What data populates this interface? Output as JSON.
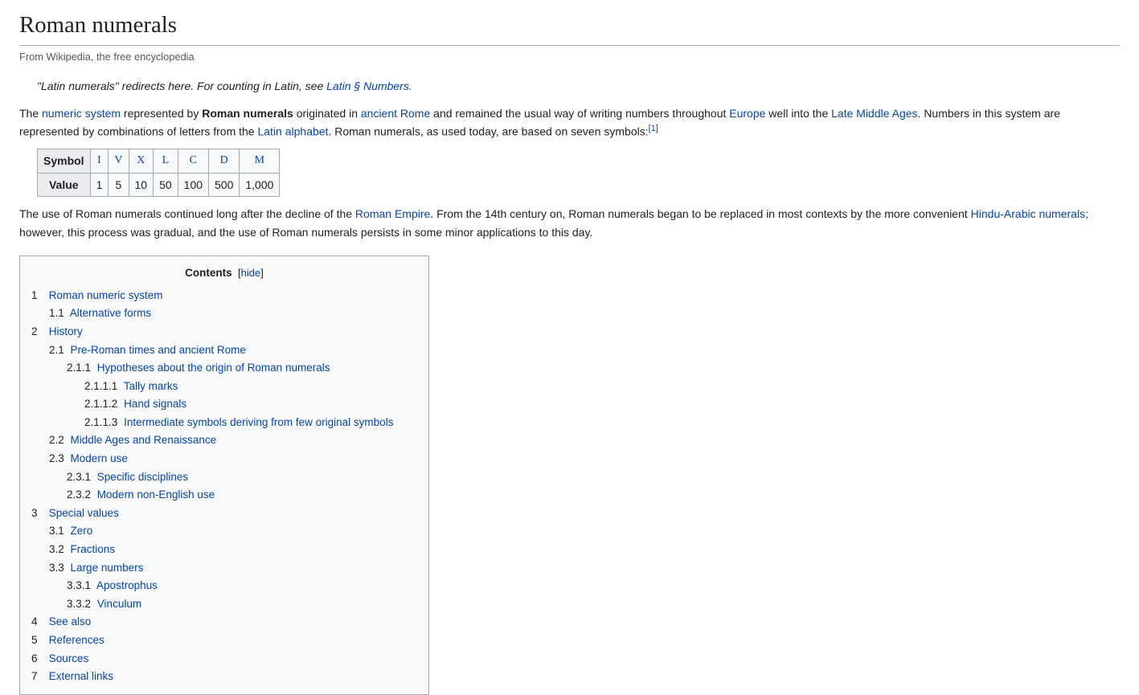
{
  "title": "Roman numerals",
  "subtitle": "From Wikipedia, the free encyclopedia",
  "hatnote": {
    "prefix": "\"Latin numerals\" redirects here. For counting in Latin, see ",
    "link": "Latin § Numbers",
    "suffix": "."
  },
  "intro": {
    "p1_a": "The ",
    "p1_link1": "numeric system",
    "p1_b": " represented by ",
    "p1_bold": "Roman numerals",
    "p1_c": " originated in ",
    "p1_link2": "ancient Rome",
    "p1_d": " and remained the usual way of writing numbers throughout ",
    "p1_link3": "Europe",
    "p1_e": " well into the ",
    "p1_link4": "Late Middle Ages",
    "p1_f": ". Numbers in this system are represented by combinations of letters from the ",
    "p1_link5": "Latin alphabet",
    "p1_g": ". Roman numerals, as used today, are based on seven symbols:",
    "p1_ref": "[1]"
  },
  "table": {
    "header_symbol": "Symbol",
    "header_value": "Value",
    "symbols": [
      "I",
      "V",
      "X",
      "L",
      "C",
      "D",
      "M"
    ],
    "values": [
      "1",
      "5",
      "10",
      "50",
      "100",
      "500",
      "1,000"
    ]
  },
  "para2": {
    "a": "The use of Roman numerals continued long after the decline of the ",
    "link1": "Roman Empire",
    "b": ". From the 14th century on, Roman numerals began to be replaced in most contexts by the more convenient ",
    "link2": "Hindu-Arabic numerals",
    "c": "; however, this process was gradual, and the use of Roman numerals persists in some minor applications to this day."
  },
  "toc": {
    "title": "Contents",
    "toggle": "hide",
    "items": [
      {
        "n": "1",
        "t": "Roman numeric system",
        "lvl": 1
      },
      {
        "n": "1.1",
        "t": "Alternative forms",
        "lvl": 2
      },
      {
        "n": "2",
        "t": "History",
        "lvl": 1
      },
      {
        "n": "2.1",
        "t": "Pre-Roman times and ancient Rome",
        "lvl": 2
      },
      {
        "n": "2.1.1",
        "t": "Hypotheses about the origin of Roman numerals",
        "lvl": 3
      },
      {
        "n": "2.1.1.1",
        "t": "Tally marks",
        "lvl": 4
      },
      {
        "n": "2.1.1.2",
        "t": "Hand signals",
        "lvl": 4
      },
      {
        "n": "2.1.1.3",
        "t": "Intermediate symbols deriving from few original symbols",
        "lvl": 4
      },
      {
        "n": "2.2",
        "t": "Middle Ages and Renaissance",
        "lvl": 2
      },
      {
        "n": "2.3",
        "t": "Modern use",
        "lvl": 2
      },
      {
        "n": "2.3.1",
        "t": "Specific disciplines",
        "lvl": 3
      },
      {
        "n": "2.3.2",
        "t": "Modern non-English use",
        "lvl": 3
      },
      {
        "n": "3",
        "t": "Special values",
        "lvl": 1
      },
      {
        "n": "3.1",
        "t": "Zero",
        "lvl": 2
      },
      {
        "n": "3.2",
        "t": "Fractions",
        "lvl": 2
      },
      {
        "n": "3.3",
        "t": "Large numbers",
        "lvl": 2
      },
      {
        "n": "3.3.1",
        "t": "Apostrophus",
        "lvl": 3
      },
      {
        "n": "3.3.2",
        "t": "Vinculum",
        "lvl": 3
      },
      {
        "n": "4",
        "t": "See also",
        "lvl": 1
      },
      {
        "n": "5",
        "t": "References",
        "lvl": 1
      },
      {
        "n": "6",
        "t": "Sources",
        "lvl": 1
      },
      {
        "n": "7",
        "t": "External links",
        "lvl": 1
      }
    ]
  }
}
